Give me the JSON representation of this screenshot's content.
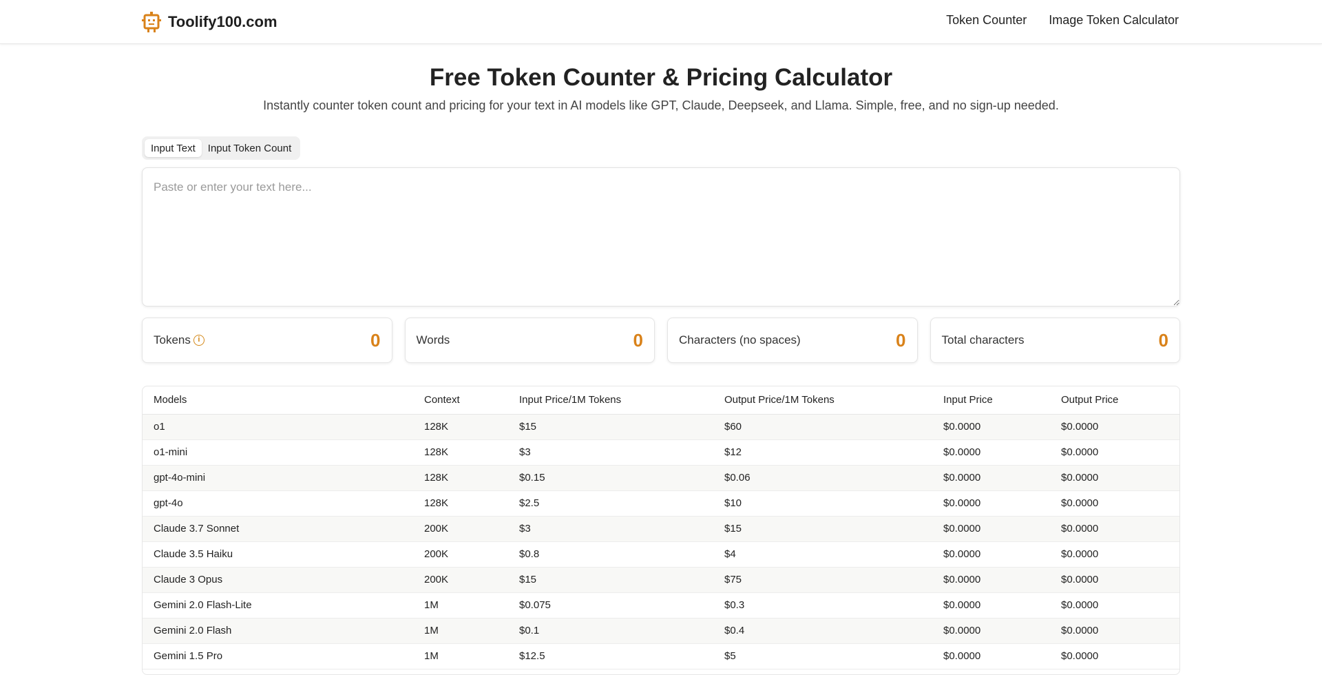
{
  "header": {
    "logo_text": "Toolify100.com",
    "nav": [
      "Token Counter",
      "Image Token Calculator"
    ]
  },
  "hero": {
    "title": "Free Token Counter & Pricing Calculator",
    "subtitle": "Instantly counter token count and pricing for your text in AI models like GPT, Claude, Deepseek, and Llama. Simple, free, and no sign-up needed."
  },
  "tabs": [
    {
      "label": "Input Text",
      "active": true
    },
    {
      "label": "Input Token Count",
      "active": false
    }
  ],
  "input": {
    "placeholder": "Paste or enter your text here...",
    "value": ""
  },
  "stats": [
    {
      "label": "Tokens",
      "value": "0",
      "has_info": true
    },
    {
      "label": "Words",
      "value": "0",
      "has_info": false
    },
    {
      "label": "Characters (no spaces)",
      "value": "0",
      "has_info": false
    },
    {
      "label": "Total characters",
      "value": "0",
      "has_info": false
    }
  ],
  "table": {
    "columns": [
      "Models",
      "Context",
      "Input Price/1M Tokens",
      "Output Price/1M Tokens",
      "Input Price",
      "Output Price"
    ],
    "rows": [
      [
        "o1",
        "128K",
        "$15",
        "$60",
        "$0.0000",
        "$0.0000"
      ],
      [
        "o1-mini",
        "128K",
        "$3",
        "$12",
        "$0.0000",
        "$0.0000"
      ],
      [
        "gpt-4o-mini",
        "128K",
        "$0.15",
        "$0.06",
        "$0.0000",
        "$0.0000"
      ],
      [
        "gpt-4o",
        "128K",
        "$2.5",
        "$10",
        "$0.0000",
        "$0.0000"
      ],
      [
        "Claude 3.7 Sonnet",
        "200K",
        "$3",
        "$15",
        "$0.0000",
        "$0.0000"
      ],
      [
        "Claude 3.5 Haiku",
        "200K",
        "$0.8",
        "$4",
        "$0.0000",
        "$0.0000"
      ],
      [
        "Claude 3 Opus",
        "200K",
        "$15",
        "$75",
        "$0.0000",
        "$0.0000"
      ],
      [
        "Gemini 2.0 Flash-Lite",
        "1M",
        "$0.075",
        "$0.3",
        "$0.0000",
        "$0.0000"
      ],
      [
        "Gemini 2.0 Flash",
        "1M",
        "$0.1",
        "$0.4",
        "$0.0000",
        "$0.0000"
      ],
      [
        "Gemini 1.5 Pro",
        "1M",
        "$12.5",
        "$5",
        "$0.0000",
        "$0.0000"
      ]
    ]
  },
  "colors": {
    "accent": "#d9821a",
    "border": "#e6e6e6",
    "row_alt": "#f8f8f6"
  },
  "icons": {
    "logo": "robot-icon",
    "tokens_info": "info-icon"
  }
}
